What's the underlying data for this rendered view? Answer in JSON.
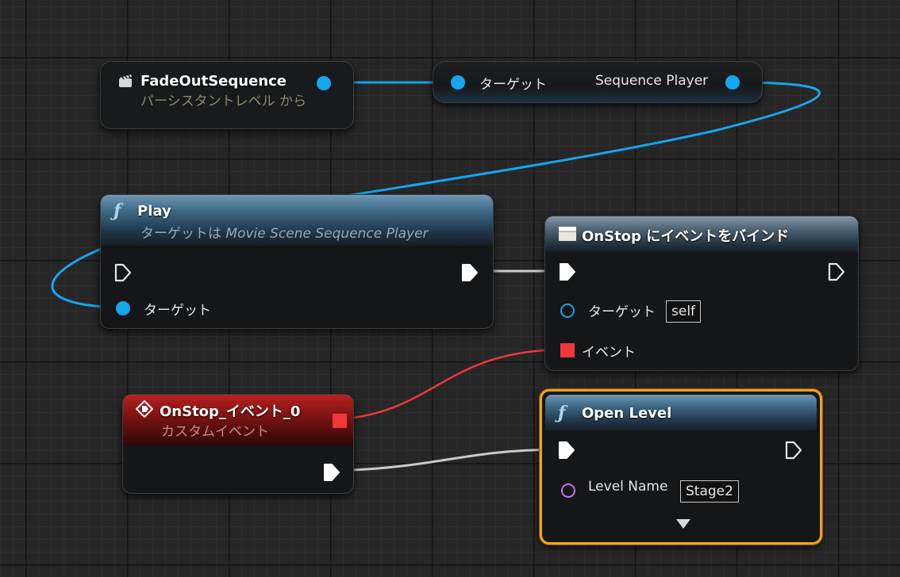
{
  "nodes": {
    "fade_out_sequence": {
      "title": "FadeOutSequence",
      "subtitle": "パーシスタントレベル から",
      "icon": "level-actor-icon"
    },
    "sequence_player_getter": {
      "input_label": "ターゲット",
      "output_label": "Sequence Player"
    },
    "play": {
      "title": "Play",
      "subtitle_prefix": "ターゲットは",
      "subtitle_class": "Movie Scene Sequence Player",
      "target_label": "ターゲット",
      "icon": "function-icon"
    },
    "bind_on_stop": {
      "title": "OnStop にイベントをバインド",
      "target_label": "ターゲット",
      "target_value": "self",
      "event_label": "イベント",
      "icon": "delegate-bind-icon"
    },
    "custom_event": {
      "title": "OnStop_イベント_0",
      "subtitle": "カスタムイベント",
      "icon": "custom-event-icon"
    },
    "open_level": {
      "title": "Open Level",
      "level_name_label": "Level Name",
      "level_name_value": "Stage2",
      "icon": "function-icon",
      "expand_icon": "triangle-down-icon"
    }
  },
  "colors": {
    "object_pin": "#14a6ef",
    "event_pin": "#f0373a",
    "name_pin": "#c774e8",
    "exec_wire": "#c9c9c9",
    "selection": "#f0a21d"
  }
}
